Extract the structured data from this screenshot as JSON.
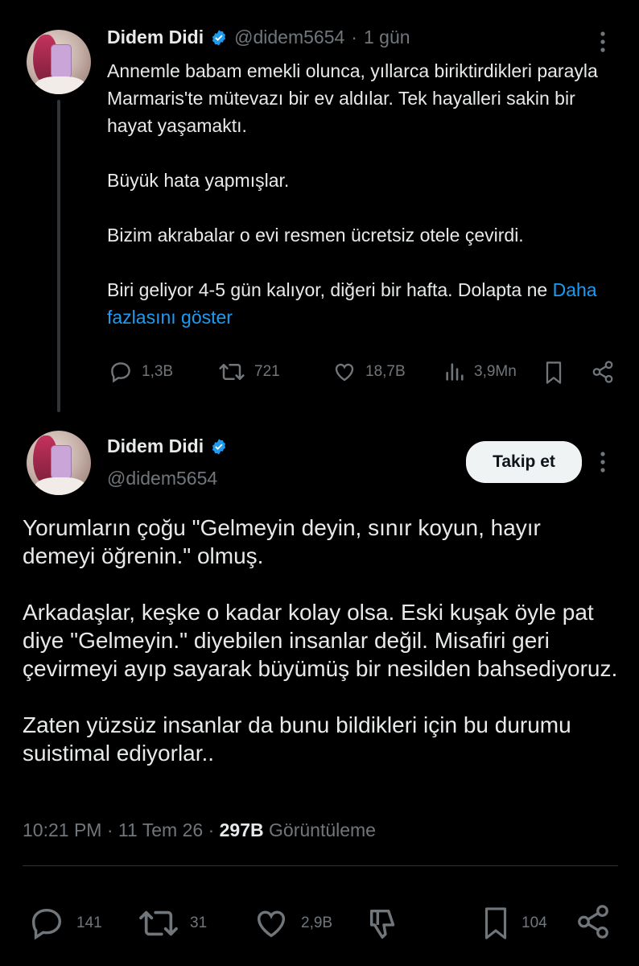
{
  "tweet1": {
    "author_name": "Didem Didi",
    "handle": "@didem5654",
    "separator": "·",
    "time": "1 gün",
    "paragraphs": [
      "Annemle babam emekli olunca, yıllarca biriktirdikleri parayla Marmaris'te mütevazı bir ev aldılar. Tek hayalleri sakin bir hayat yaşamaktı.",
      "Büyük hata yapmışlar.",
      "Bizim akrabalar o evi resmen ücretsiz otele çevirdi."
    ],
    "last_paragraph": "Biri geliyor 4-5 gün kalıyor, diğeri bir hafta. Dolapta ne",
    "show_more": "Daha fazlasını göster",
    "replies": "1,3B",
    "retweets": "721",
    "likes": "18,7B",
    "views": "3,9Mn"
  },
  "tweet2": {
    "author_name": "Didem Didi",
    "handle": "@didem5654",
    "follow_label": "Takip et",
    "paragraphs": [
      "Yorumların çoğu \"Gelmeyin deyin, sınır koyun, hayır demeyi öğrenin.\" olmuş.",
      "Arkadaşlar, keşke o kadar kolay olsa. Eski kuşak öyle pat diye \"Gelmeyin.\" diyebilen insanlar değil. Misafiri geri çevirmeyi ayıp sayarak büyümüş bir nesilden bahsediyoruz.",
      "Zaten yüzsüz insanlar da bunu bildikleri için bu durumu suistimal ediyorlar.."
    ],
    "time": "10:21 PM",
    "date": "11 Tem 26",
    "views_count": "297B",
    "views_label": "Görüntüleme",
    "dot": "·",
    "replies": "141",
    "retweets": "31",
    "likes": "2,9B",
    "bookmarks": "104"
  },
  "colors": {
    "background": "#000000",
    "text": "#e7e9ea",
    "muted": "#71767b",
    "link": "#1d9bf0",
    "verified": "#1d9bf0"
  }
}
